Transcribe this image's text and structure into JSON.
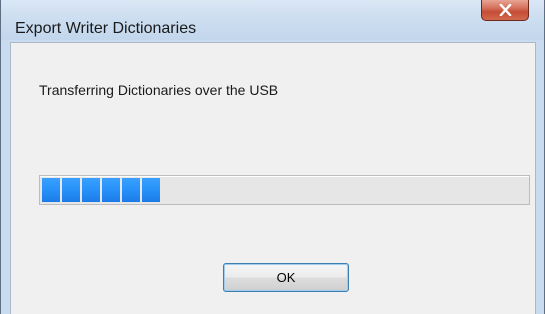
{
  "window": {
    "title": "Export Writer Dictionaries",
    "close_icon": "close-icon"
  },
  "dialog": {
    "message": "Transferring Dictionaries over the USB",
    "progress": {
      "value_fraction": 0.25,
      "color": "#2691f8"
    },
    "ok_label": "OK"
  },
  "colors": {
    "title_bar": "#cddef1",
    "close_button": "#c44c34",
    "dialog_background": "#f0f0f0",
    "progress_segment": "#2691f8"
  }
}
